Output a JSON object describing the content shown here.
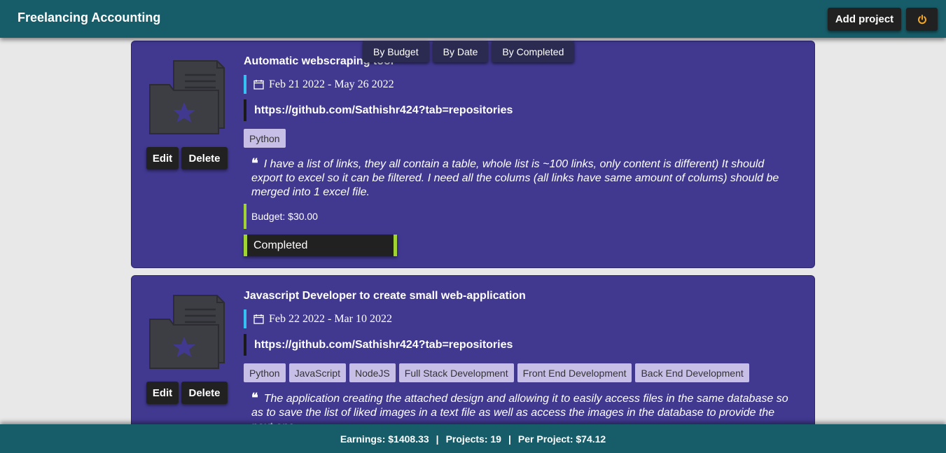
{
  "header": {
    "title": "Freelancing Accounting",
    "add_project_label": "Add project",
    "power_icon": "power-icon"
  },
  "sort": {
    "by_budget": "By Budget",
    "by_date": "By Date",
    "by_completed": "By Completed"
  },
  "actions": {
    "edit": "Edit",
    "delete": "Delete"
  },
  "projects": [
    {
      "title": "Automatic webscraping tool",
      "start_date": "Feb 21 2022",
      "end_date": "May 26 2022",
      "link": "https://github.com/Sathishr424?tab=repositories",
      "tags": [
        "Python"
      ],
      "description": "I have a list of links, they all contain a table, whole list is ~100 links, only content is different) It should export to excel so it can be filtered. I need all the colums (all links have same amount of colums) should be merged into 1 excel file.",
      "budget": "Budget: $30.00",
      "status": "Completed"
    },
    {
      "title": "Javascript Developer to create small web-application",
      "start_date": "Feb 22 2022",
      "end_date": "Mar 10 2022",
      "link": "https://github.com/Sathishr424?tab=repositories",
      "tags": [
        "Python",
        "JavaScript",
        "NodeJS",
        "Full Stack Development",
        "Front End Development",
        "Back End Development"
      ],
      "description": "The application creating the attached design and allowing it to easily access files in the same database so as to save the list of liked images in a text file as well as access the images in the database to provide the next one"
    }
  ],
  "footer": {
    "earnings": "Earnings: $1408.33",
    "projects": "Projects: 19",
    "per_project": "Per Project: $74.12",
    "separator": "|"
  },
  "colors": {
    "header_bg": "#175d69",
    "card_bg": "#413990",
    "date_accent": "#35c1f1",
    "budget_accent": "#a1d334",
    "tag_bg": "#c8bfe7",
    "power_icon": "#f5a623"
  }
}
